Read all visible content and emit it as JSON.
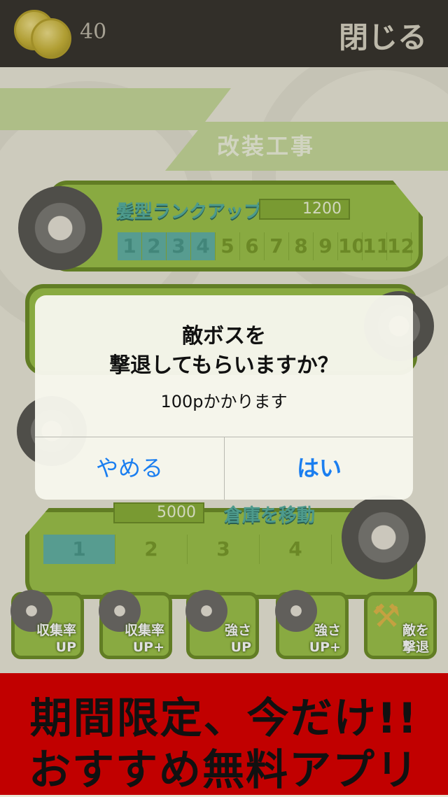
{
  "header": {
    "coin_count": "40",
    "close_label": "閉じる"
  },
  "screen": {
    "title": "改装工事",
    "hair_panel": {
      "label": "髪型ランクアップ",
      "cost": "1200",
      "ranks": [
        "1",
        "2",
        "3",
        "4",
        "5",
        "6",
        "7",
        "8",
        "9",
        "10",
        "11",
        "12"
      ],
      "active_count": 4
    },
    "warehouse_panel": {
      "label": "倉庫を移動",
      "cost": "5000",
      "levels": [
        "1",
        "2",
        "3",
        "4"
      ],
      "active_count": 1
    },
    "buttons": [
      {
        "line1": "収集率",
        "line2": "UP"
      },
      {
        "line1": "収集率",
        "line2": "UP+"
      },
      {
        "line1": "強さ",
        "line2": "UP"
      },
      {
        "line1": "強さ",
        "line2": "UP+"
      },
      {
        "line1": "敵を",
        "line2": "撃退"
      }
    ]
  },
  "dialog": {
    "title_line1": "敵ボスを",
    "title_line2": "撃退してもらいますか？",
    "message": "100pかかります",
    "cancel_label": "やめる",
    "ok_label": "はい"
  },
  "ad": {
    "line1": "期間限定、今だけ!!",
    "line2": "おすすめ無料アプリ"
  },
  "colors": {
    "accent": "#1a7ef0",
    "panel_green": "#9dc24a",
    "ad_red": "#c10000"
  }
}
